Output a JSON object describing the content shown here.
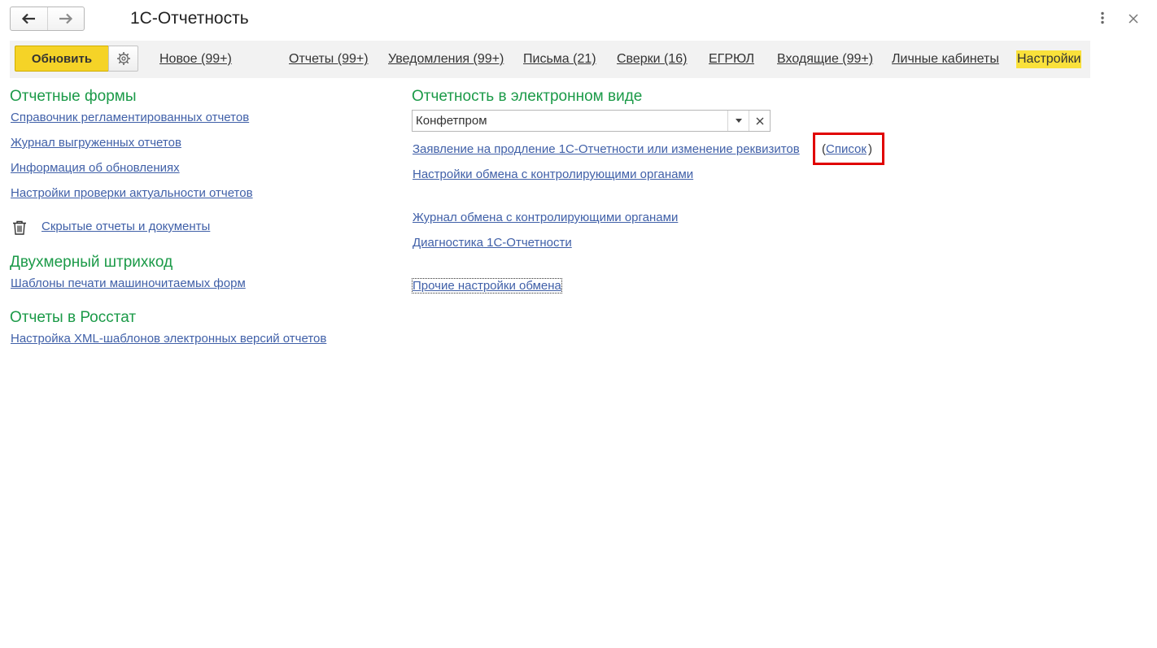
{
  "window": {
    "title": "1С-Отчетность"
  },
  "toolbar": {
    "refresh_label": "Обновить",
    "tabs": [
      "Новое (99+)",
      "Отчеты (99+)",
      "Уведомления (99+)",
      "Письма (21)",
      "Сверки (16)",
      "ЕГРЮЛ",
      "Входящие (99+)",
      "Личные кабинеты",
      "Настройки"
    ]
  },
  "left": {
    "forms_title": "Отчетные формы",
    "forms_links": [
      "Справочник регламентированных отчетов",
      "Журнал выгруженных отчетов",
      "Информация об обновлениях",
      "Настройки проверки актуальности отчетов"
    ],
    "hidden_link": "Скрытые отчеты и документы",
    "barcode_title": "Двухмерный штрихкод",
    "barcode_link": "Шаблоны печати машиночитаемых форм",
    "rosstat_title": "Отчеты в Росстат",
    "rosstat_link": "Настройка XML-шаблонов электронных версий отчетов"
  },
  "right": {
    "title": "Отчетность в электронном виде",
    "org_value": "Конфетпром",
    "application_link": "Заявление на продление 1С-Отчетности или изменение реквизитов",
    "paren_open": "(",
    "list_link": "Список",
    "paren_close": ")",
    "exchange_settings_link": "Настройки обмена с контролирующими органами",
    "exchange_log_link": "Журнал обмена с контролирующими органами",
    "diagnostics_link": "Диагностика 1С-Отчетности",
    "other_settings_link": "Прочие настройки обмена"
  },
  "colors": {
    "accent_yellow": "#f5d327",
    "section_green": "#1b9a48",
    "link_blue": "#4060a8",
    "highlight_red": "#e00000"
  }
}
